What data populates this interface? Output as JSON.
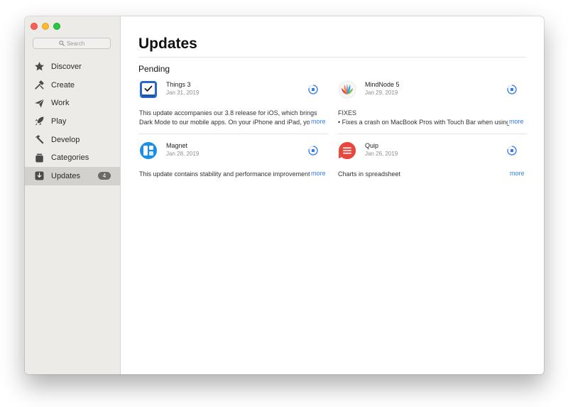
{
  "sidebar": {
    "search_placeholder": "Search",
    "items": [
      {
        "label": "Discover",
        "icon": "star-icon"
      },
      {
        "label": "Create",
        "icon": "hammer-brush-icon"
      },
      {
        "label": "Work",
        "icon": "paper-plane-icon"
      },
      {
        "label": "Play",
        "icon": "rocket-icon"
      },
      {
        "label": "Develop",
        "icon": "hammer-icon"
      },
      {
        "label": "Categories",
        "icon": "square-stack-icon"
      },
      {
        "label": "Updates",
        "icon": "download-tray-icon",
        "badge": "4",
        "selected": true
      }
    ]
  },
  "main": {
    "title": "Updates",
    "section": "Pending",
    "more_label": "more",
    "updates": [
      {
        "name": "Things 3",
        "date": "Jan 31, 2019",
        "icon": "things-app-icon",
        "description": [
          "This update accompanies our 3.8 release for iOS, which brings",
          "Dark Mode to our mobile apps. On your iPhone and iPad, you can"
        ]
      },
      {
        "name": "MindNode 5",
        "date": "Jan 29, 2019",
        "icon": "mindnode-app-icon",
        "description": [
          "FIXES",
          "• Fixes a crash on MacBook Pros with Touch Bar when using"
        ]
      },
      {
        "name": "Magnet",
        "date": "Jan 28, 2019",
        "icon": "magnet-app-icon",
        "description": [
          "This update contains stability and performance improvements."
        ]
      },
      {
        "name": "Quip",
        "date": "Jan 26, 2019",
        "icon": "quip-app-icon",
        "description": [
          "Charts in spreadsheet"
        ]
      }
    ]
  },
  "colors": {
    "accent": "#2f7cf6",
    "sidebar_bg": "#ecebe8",
    "selected_bg": "#d2d1ce",
    "badge_bg": "#6b6a68"
  }
}
